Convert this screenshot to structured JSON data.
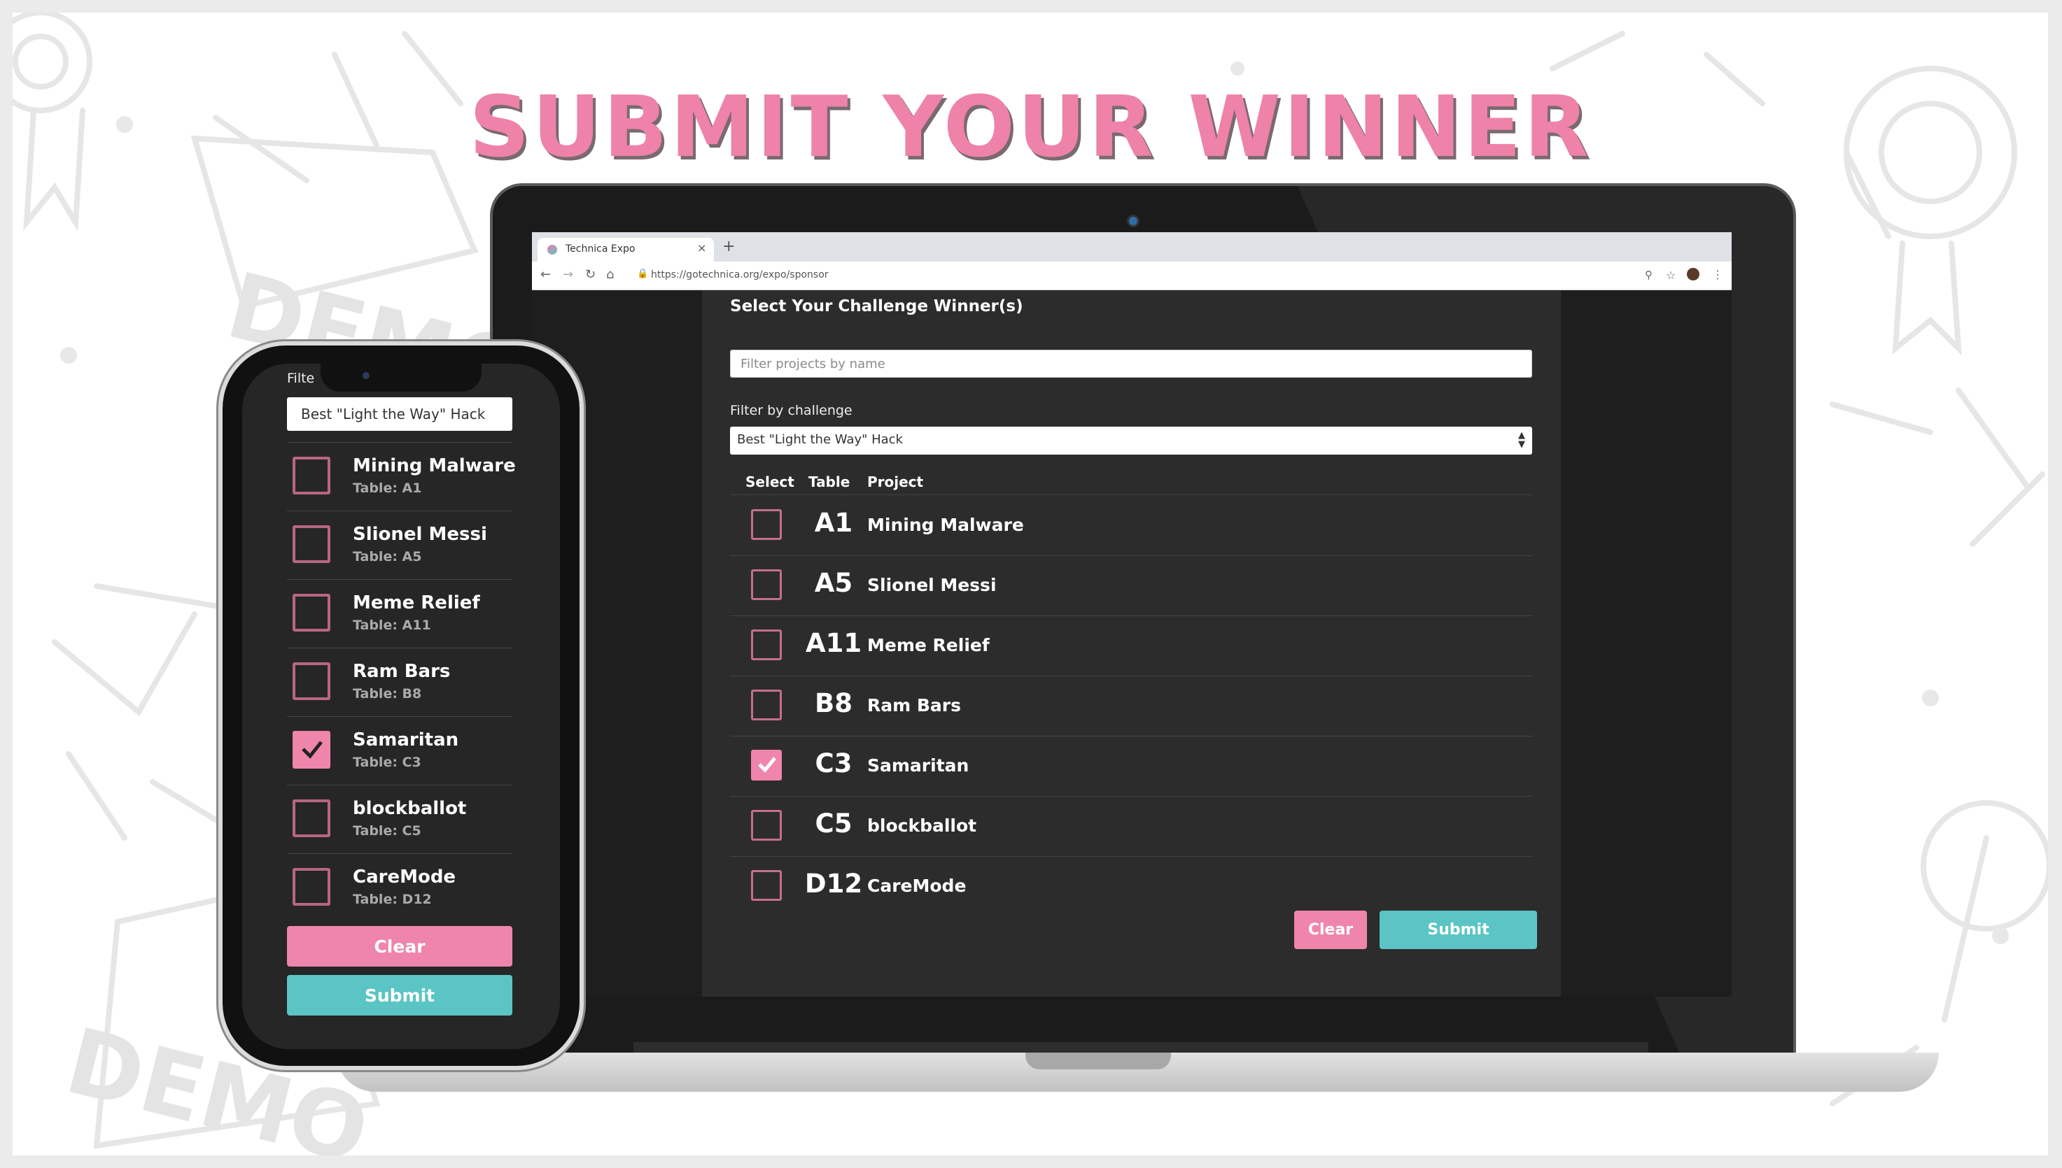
{
  "banner": {
    "title": "SUBMIT YOUR WINNER"
  },
  "colors": {
    "accent_pink": "#ef85ab",
    "accent_teal": "#5bc4c4",
    "panel": "#2c2c2c",
    "title_pink": "#ee82a8"
  },
  "browser": {
    "tab_title": "Technica Expo",
    "tab_close": "×",
    "new_tab": "+",
    "url": "https://gotechnica.org/expo/sponsor",
    "icons": [
      "back-icon",
      "forward-icon",
      "reload-icon",
      "home-icon",
      "lock-icon",
      "zoom-icon",
      "star-icon",
      "profile-icon",
      "menu-icon"
    ]
  },
  "form": {
    "heading": "Select Your Challenge Winner(s)",
    "search_placeholder": "Filter projects by name",
    "filter_label": "Filter by challenge",
    "selected_challenge": "Best \"Light the Way\" Hack",
    "columns": [
      "Select",
      "Table",
      "Project"
    ],
    "clear_label": "Clear",
    "submit_label": "Submit"
  },
  "projects": [
    {
      "table": "A1",
      "name": "Mining Malware",
      "table_label": "Table: A1",
      "checked": false
    },
    {
      "table": "A5",
      "name": "Slionel Messi",
      "table_label": "Table: A5",
      "checked": false
    },
    {
      "table": "A11",
      "name": "Meme Relief",
      "table_label": "Table: A11",
      "checked": false
    },
    {
      "table": "B8",
      "name": "Ram Bars",
      "table_label": "Table: B8",
      "checked": false
    },
    {
      "table": "C3",
      "name": "Samaritan",
      "table_label": "Table: C3",
      "checked": true
    },
    {
      "table": "C5",
      "name": "blockballot",
      "table_label": "Table: C5",
      "checked": false
    },
    {
      "table": "D12",
      "name": "CareMode",
      "table_label": "Table: D12",
      "checked": false
    }
  ],
  "phone": {
    "filter_label": "Filte",
    "selected_challenge": "Best \"Light the Way\" Hack",
    "clear_label": "Clear",
    "submit_label": "Submit"
  }
}
